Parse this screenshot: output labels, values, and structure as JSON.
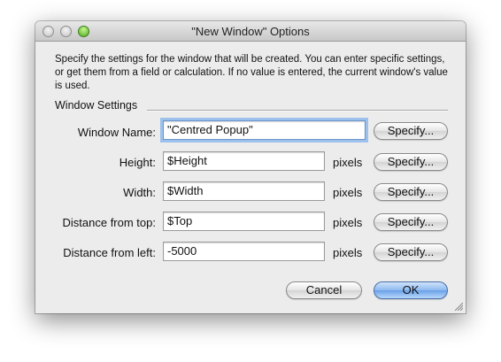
{
  "window": {
    "title": "\"New Window\" Options"
  },
  "description": "Specify the settings for the window that will be created. You can enter specific settings, or get them from a field or calculation. If no value is entered, the current window's value is used.",
  "group": {
    "label": "Window Settings"
  },
  "fields": [
    {
      "label": "Window Name:",
      "value": "\"Centred Popup\"",
      "units": "",
      "button": "Specify..."
    },
    {
      "label": "Height:",
      "value": "$Height",
      "units": "pixels",
      "button": "Specify..."
    },
    {
      "label": "Width:",
      "value": "$Width",
      "units": "pixels",
      "button": "Specify..."
    },
    {
      "label": "Distance from top:",
      "value": "$Top",
      "units": "pixels",
      "button": "Specify..."
    },
    {
      "label": "Distance from left:",
      "value": "-5000",
      "units": "pixels",
      "button": "Specify..."
    }
  ],
  "buttons": {
    "cancel": "Cancel",
    "ok": "OK"
  }
}
